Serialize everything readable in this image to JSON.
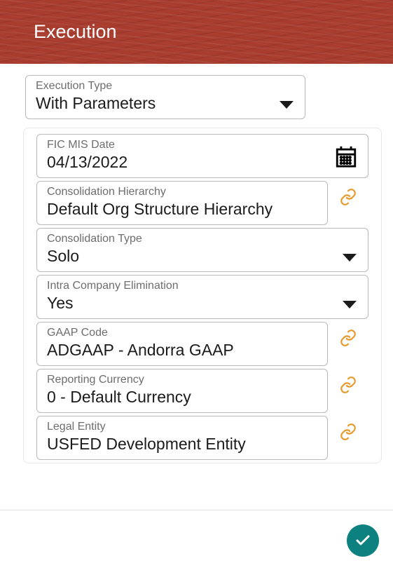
{
  "header": {
    "title": "Execution"
  },
  "executionType": {
    "label": "Execution Type",
    "value": "With Parameters"
  },
  "fields": {
    "ficMisDate": {
      "label": "FIC MIS Date",
      "value": "04/13/2022"
    },
    "consHierarchy": {
      "label": "Consolidation Hierarchy",
      "value": "Default Org Structure Hierarchy"
    },
    "consType": {
      "label": "Consolidation Type",
      "value": "Solo"
    },
    "intraElim": {
      "label": "Intra Company Elimination",
      "value": "Yes"
    },
    "gaap": {
      "label": "GAAP Code",
      "value": "ADGAAP -  Andorra GAAP"
    },
    "repCurrency": {
      "label": "Reporting Currency",
      "value": "0 - Default Currency"
    },
    "legalEntity": {
      "label": "Legal Entity",
      "value": "USFED Development Entity"
    }
  }
}
